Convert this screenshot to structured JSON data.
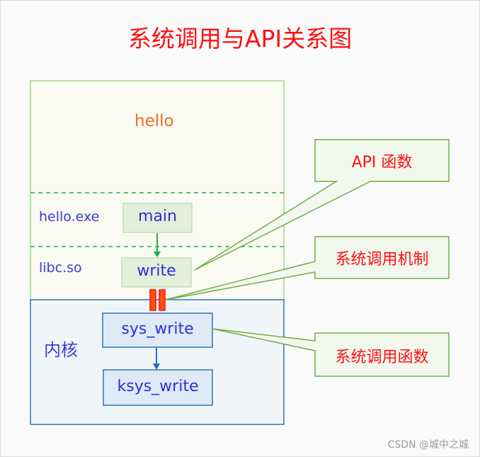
{
  "title": "系统调用与API关系图",
  "user_space": {
    "program_label": "hello",
    "layers": [
      {
        "label": "hello.exe",
        "function": "main"
      },
      {
        "label": "libc.so",
        "function": "write"
      }
    ]
  },
  "kernel": {
    "label": "内核",
    "functions": [
      "sys_write",
      "ksys_write"
    ]
  },
  "callouts": {
    "api": "API 函数",
    "mechanism": "系统调用机制",
    "syscall_function": "系统调用函数"
  },
  "colors": {
    "title": "#ff1010",
    "user_border": "#a9d18e",
    "kernel_border": "#2e75b6",
    "gate": "#ff5010"
  },
  "watermark": "CSDN @城中之城"
}
